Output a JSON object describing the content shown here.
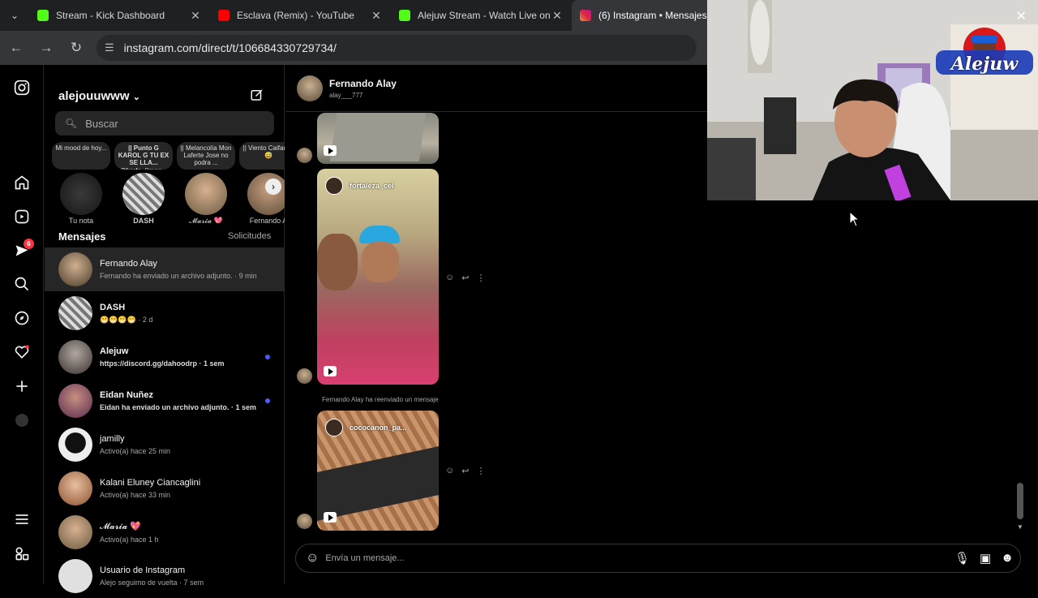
{
  "browser": {
    "tabs": [
      {
        "title": "Stream - Kick Dashboard",
        "icon": "kick-icon"
      },
      {
        "title": "Esclava (Remix) - YouTube",
        "icon": "youtube-icon"
      },
      {
        "title": "Alejuw Stream - Watch Live on K",
        "icon": "kick-icon"
      },
      {
        "title": "(6) Instagram • Mensajes",
        "icon": "instagram-icon"
      }
    ],
    "url": "instagram.com/direct/t/106684330729734/"
  },
  "nav": {
    "notifications_badge": "6"
  },
  "inbox": {
    "username": "alejouuwww",
    "search_placeholder": "Buscar",
    "notes": [
      {
        "text": "Mi mood de hoy...",
        "name": "Tu nota"
      },
      {
        "text": "|⁦|⁩ Punto G KAROL G TU EX SE LLA... @karla_jimen...",
        "name": "DASH"
      },
      {
        "text": "|| Melancolía Mon Laferte Jose no podra ...",
        "name": "𝓜𝓪𝓻𝓲𝓪 💖"
      },
      {
        "text": "|| Viento Caifanes 😅",
        "name": "Fernando A"
      }
    ],
    "section_title": "Mensajes",
    "requests_label": "Solicitudes",
    "threads": [
      {
        "name": "Fernando Alay",
        "preview": "Fernando ha enviado un archivo adjunto. · 9 min",
        "bold": false,
        "unread": false
      },
      {
        "name": "DASH",
        "preview": "😁😁😁😁 · 2 d",
        "bold": false,
        "unread": false
      },
      {
        "name": "Alejuw",
        "preview": "https://discord.gg/dahoodrp · 1 sem",
        "bold": true,
        "unread": true
      },
      {
        "name": "Eidan Nuñez",
        "preview": "Eidan ha enviado un archivo adjunto. · 1 sem",
        "bold": true,
        "unread": true
      },
      {
        "name": "jamilly",
        "preview": "Activo(a) hace 25 min",
        "bold": false,
        "unread": false
      },
      {
        "name": "Kalani Eluney Ciancaglini",
        "preview": "Activo(a) hace 33 min",
        "bold": false,
        "unread": false
      },
      {
        "name": "𝓜𝓪𝓻𝓲𝓪 💖",
        "preview": "Activo(a) hace 1 h",
        "bold": false,
        "unread": false
      },
      {
        "name": "Usuario de Instagram",
        "preview": "Alejo seguimo de vuelta · 7 sem",
        "bold": false,
        "unread": false
      }
    ]
  },
  "chat": {
    "name": "Fernando Alay",
    "username": "alay___777",
    "reel_handles": [
      "fortaleza_cel",
      "cococanon_pa..."
    ],
    "forwarded_label": "Fernando Alay ha reenviado un mensaje",
    "composer_placeholder": "Envía un mensaje..."
  },
  "overlay": {
    "streamer_logo_text": "Alejuw"
  },
  "colors": {
    "unread_dot": "#4a5df9",
    "badge": "#ff3040"
  }
}
